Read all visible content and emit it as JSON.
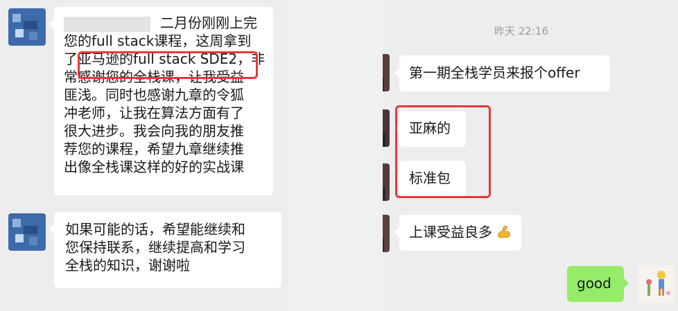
{
  "left_chat": {
    "msg1_lines": [
      "二月份刚刚上完",
      "您的full stack课程，这周拿到",
      "了亚马逊的full stack SDE2，非",
      "常感谢您的全栈课，让我受益",
      "匪浅。同时也感谢九章的令狐",
      "冲老师，让我在算法方面有了",
      "很大进步。我会向我的朋友推",
      "荐您的课程，希望九章继续推",
      "出像全栈课这样的好的实战课"
    ],
    "msg2_lines": [
      "如果可能的话，希望能继续和",
      "您保持联系，继续提高和学习",
      "全栈的知识，谢谢啦"
    ]
  },
  "right_chat": {
    "timestamp": "昨天 22:16",
    "messages": [
      {
        "text": "第一期全栈学员来报个offer"
      },
      {
        "text": "亚麻的"
      },
      {
        "text": "标准包"
      },
      {
        "text": "上课受益良多"
      }
    ],
    "reply": "good"
  },
  "colors": {
    "highlight": "#e8373a",
    "reply_bubble": "#95ec69",
    "bubble": "#ffffff",
    "background": "#ededed"
  },
  "icons": [
    "biceps-emoji-icon",
    "sticker-image"
  ]
}
